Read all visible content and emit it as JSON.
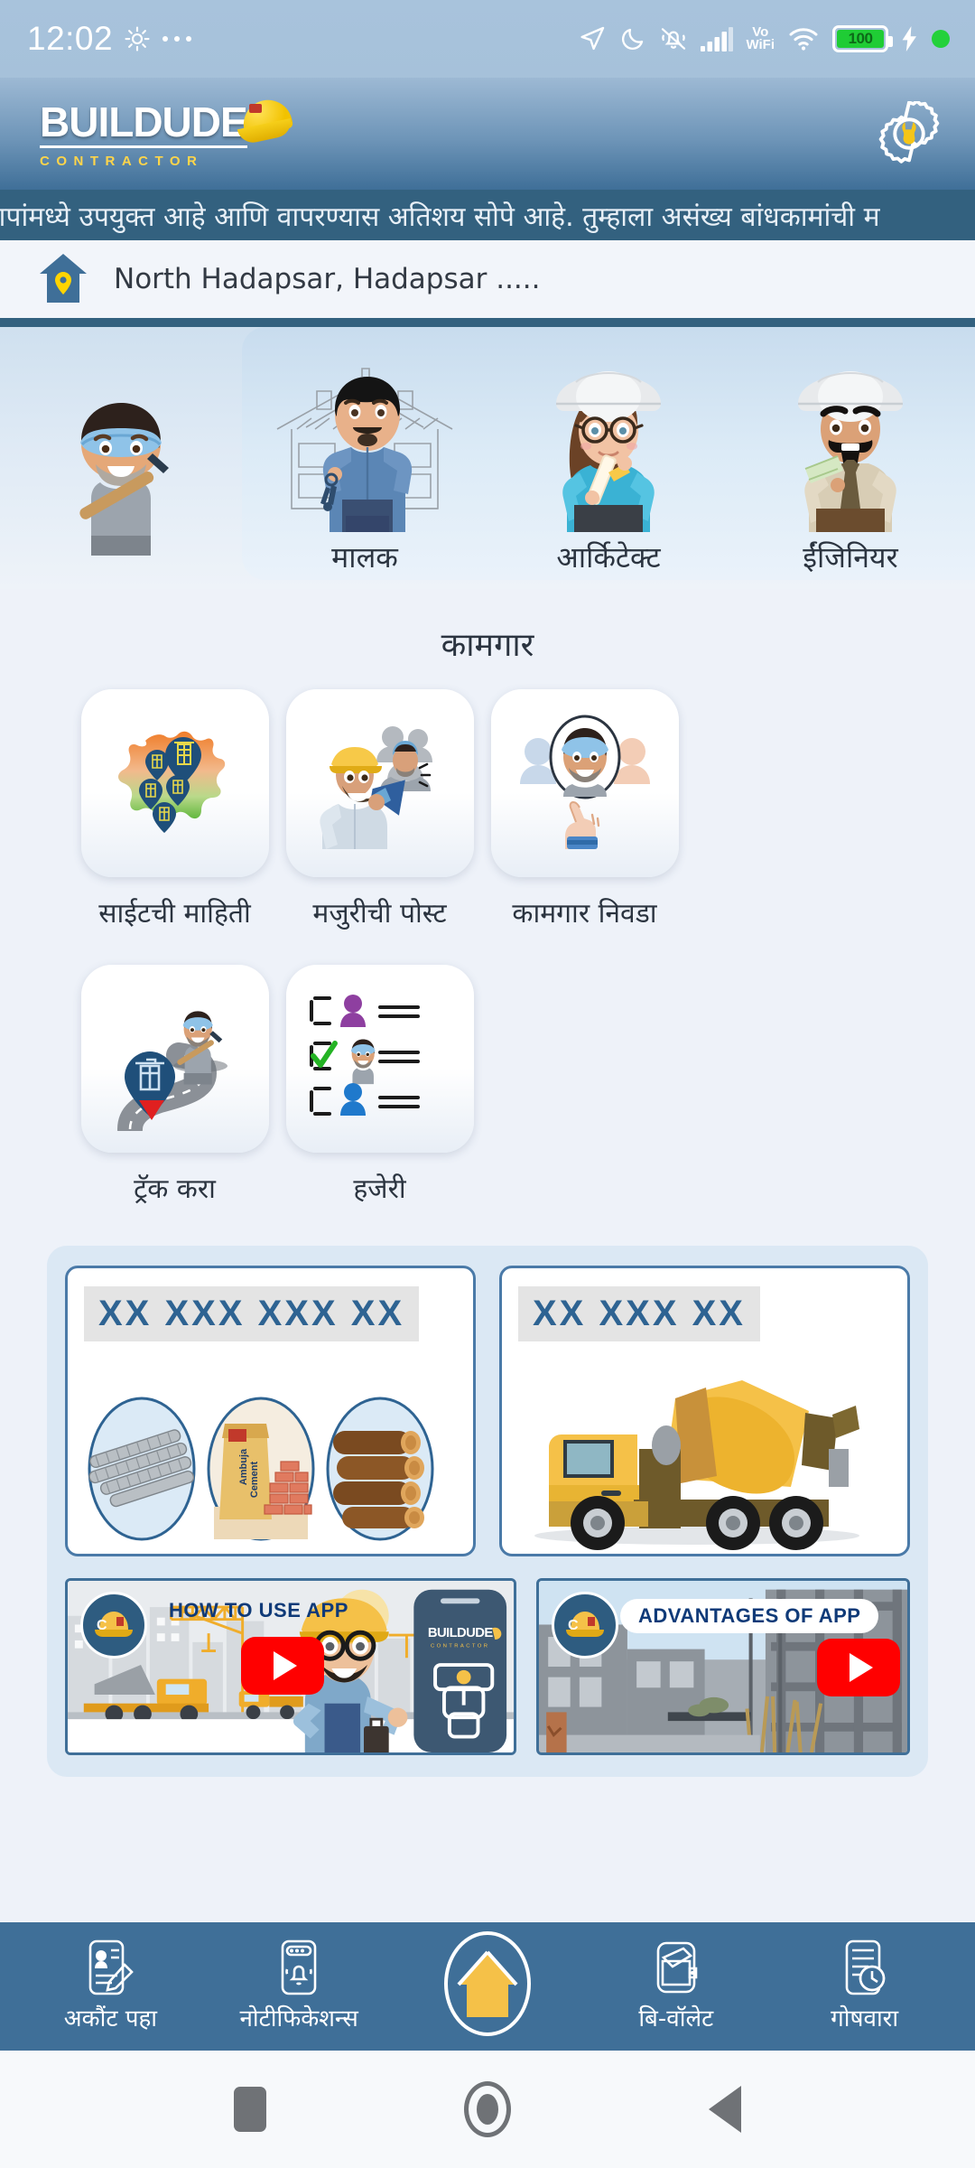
{
  "status_bar": {
    "time": "12:02",
    "left_icons": [
      "brightness-gear-icon",
      "more-dots-icon"
    ],
    "right_icons": [
      "location-arrow-icon",
      "dnd-moon-icon",
      "mute-vibrate-bell-icon",
      "signal-bars-icon",
      "wifi-icon",
      "charging-bolt-icon",
      "green-status-dot-icon"
    ],
    "vowifi_line1": "Vo",
    "vowifi_line2": "WiFi",
    "battery_percent": "100"
  },
  "header": {
    "logo_main": "BUILDUDE",
    "logo_sub": "CONTRACTOR",
    "settings_icon": "gear-wrench-icon",
    "brand_blue": "#3f6f98",
    "brand_yellow": "#ffd54a"
  },
  "marquee": {
    "text": "नापांमध्ये उपयुक्त आहे आणि वापरण्यास अतिशय सोपे आहे.  तुम्हाला असंख्य बांधकामांची म"
  },
  "location": {
    "icon": "home-location-pin-icon",
    "name": "North Hadapsar, Hadapsar ....."
  },
  "roles": [
    {
      "label": "",
      "art": "worker-avatar"
    },
    {
      "label": "मालक",
      "art": "owner-with-keys"
    },
    {
      "label": "आर्किटेक्ट",
      "art": "architect-woman"
    },
    {
      "label": "ईंजिनियर",
      "art": "engineer-man"
    }
  ],
  "section": {
    "title": "कामगार"
  },
  "tiles": [
    [
      {
        "label": "साईटची माहिती",
        "icon": "india-map-pins-icon"
      },
      {
        "label": "मजुरीची पोस्ट",
        "icon": "megaphone-worker-icon"
      },
      {
        "label": "कामगार निवडा",
        "icon": "select-worker-icon"
      }
    ],
    [
      {
        "label": "ट्रॅक करा",
        "icon": "road-track-icon"
      },
      {
        "label": "हजेरी",
        "icon": "attendance-checklist-icon"
      }
    ]
  ],
  "ads": [
    {
      "placeholder": "XX XXX XXX XX",
      "art": "materials-rebar-cement-wood"
    },
    {
      "placeholder": "XX XXX XX",
      "art": "concrete-mixer-truck"
    }
  ],
  "videos": [
    {
      "title": "HOW TO USE APP",
      "badge": "helmet-c-logo-icon",
      "play": "youtube-play-icon"
    },
    {
      "title": "ADVANTAGES OF APP",
      "badge": "helmet-c-logo-icon",
      "play": "youtube-play-icon"
    }
  ],
  "bottom_nav": [
    {
      "label": "अकौंट पहा",
      "icon": "account-card-edit-icon"
    },
    {
      "label": "नोटीफिकेशन्स",
      "icon": "notification-bell-phone-icon"
    },
    {
      "label": "",
      "icon": "home-icon",
      "active": true
    },
    {
      "label": "बि-वॉलेट",
      "icon": "wallet-icon"
    },
    {
      "label": "गोषवारा",
      "icon": "report-clock-icon"
    }
  ],
  "android_nav": [
    {
      "icon": "recents-square-icon"
    },
    {
      "icon": "home-circle-icon"
    },
    {
      "icon": "back-triangle-icon"
    }
  ]
}
